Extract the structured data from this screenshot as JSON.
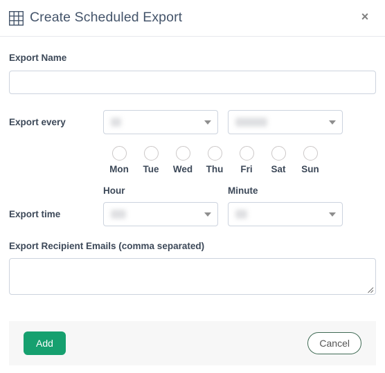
{
  "header": {
    "icon": "grid-table-icon",
    "title": "Create Scheduled Export",
    "close_label": "×"
  },
  "form": {
    "export_name": {
      "label": "Export Name",
      "value": "",
      "placeholder": ""
    },
    "export_every": {
      "label": "Export every",
      "interval_value": "",
      "unit_value": ""
    },
    "days": {
      "items": [
        {
          "label": "Mon",
          "checked": false
        },
        {
          "label": "Tue",
          "checked": false
        },
        {
          "label": "Wed",
          "checked": false
        },
        {
          "label": "Thu",
          "checked": false
        },
        {
          "label": "Fri",
          "checked": false
        },
        {
          "label": "Sat",
          "checked": false
        },
        {
          "label": "Sun",
          "checked": false
        }
      ]
    },
    "export_time": {
      "label": "Export time",
      "hour_header": "Hour",
      "minute_header": "Minute",
      "hour_value": "",
      "minute_value": ""
    },
    "recipients": {
      "label": "Export Recipient Emails (comma separated)",
      "value": "",
      "placeholder": ""
    }
  },
  "footer": {
    "add_label": "Add",
    "cancel_label": "Cancel"
  },
  "colors": {
    "accent_green": "#16a06f",
    "text_dark": "#3c4858",
    "title": "#44546a",
    "border": "#ccd3de",
    "footer_bg": "#f7f7f7"
  }
}
